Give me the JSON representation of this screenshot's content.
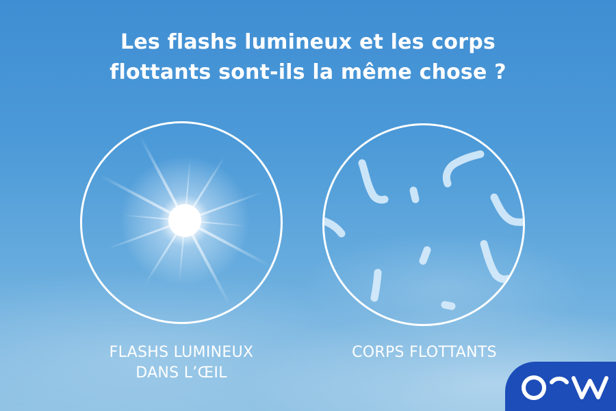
{
  "title": {
    "line1": "Les flashs lumineux et les corps",
    "line2": "flottants sont-ils la même chose ?"
  },
  "panels": [
    {
      "caption_line1": "FLASHS LUMINEUX",
      "caption_line2": "DANS L’ŒIL",
      "icon": "light-flash-icon"
    },
    {
      "caption_line1": "CORPS FLOTTANTS",
      "icon": "eye-floaters-icon"
    }
  ],
  "logo": {
    "icon": "ocw-logo",
    "badge_color": "#1d4db8"
  },
  "colors": {
    "text": "#ffffff",
    "sky_top": "#3f8ed3",
    "sky_bottom": "#8cc0e3"
  }
}
